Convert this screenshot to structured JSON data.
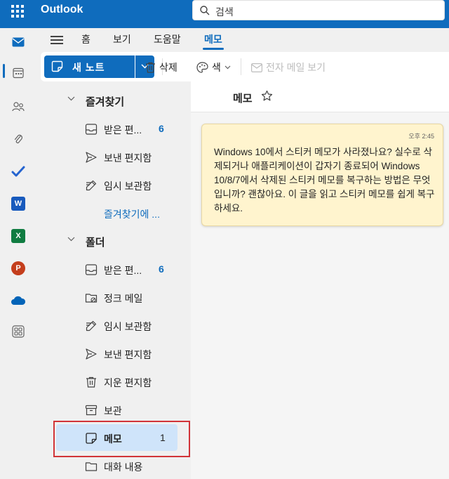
{
  "app": {
    "name": "Outlook"
  },
  "search": {
    "placeholder": "검색"
  },
  "rail": {
    "icons": [
      "mail-icon",
      "calendar-icon",
      "people-icon",
      "attachment-icon",
      "todo-icon",
      "word-icon",
      "excel-icon",
      "powerpoint-icon",
      "onedrive-icon",
      "more-apps-icon"
    ],
    "apps": {
      "word": "W",
      "excel": "X",
      "powerpoint": "P"
    },
    "colors": {
      "word": "#185abd",
      "excel": "#107c41",
      "powerpoint": "#c43e1c",
      "onedrive": "#0364b8",
      "todo": "#2564cf"
    }
  },
  "nav": {
    "tabs": [
      "홈",
      "보기",
      "도움말",
      "메모"
    ],
    "active": "메모"
  },
  "ribbon": {
    "new_note": "새 노트",
    "delete": "삭제",
    "color": "색",
    "view_email": "전자 메일 보기"
  },
  "folders": {
    "favorites": {
      "title": "즐겨찾기",
      "items": [
        {
          "label": "받은 편...",
          "count": "6",
          "icon": "inbox-icon"
        },
        {
          "label": "보낸 편지함",
          "icon": "send-icon"
        },
        {
          "label": "임시 보관함",
          "icon": "draft-icon"
        }
      ],
      "more": "즐겨찾기에 ..."
    },
    "folders": {
      "title": "폴더",
      "items": [
        {
          "label": "받은 편...",
          "count": "6",
          "icon": "inbox-icon"
        },
        {
          "label": "정크 메일",
          "icon": "junk-icon"
        },
        {
          "label": "임시 보관함",
          "icon": "draft-icon"
        },
        {
          "label": "보낸 편지함",
          "icon": "send-icon"
        },
        {
          "label": "지운 편지함",
          "icon": "trash-icon"
        },
        {
          "label": "보관",
          "icon": "archive-icon"
        },
        {
          "label": "메모",
          "count": "1",
          "icon": "note-icon",
          "selected": true
        },
        {
          "label": "대화 내용",
          "icon": "folder-icon"
        }
      ]
    }
  },
  "main": {
    "title": "메모",
    "note": {
      "time": "오후 2:45",
      "text": "Windows 10에서 스티커 메모가 사라졌나요? 실수로 삭제되거나 애플리케이션이 갑자기 종료되어 Windows 10/8/7에서 삭제된 스티커 메모를 복구하는 방법은 무엇입니까? 괜찮아요. 이 글을 읽고 스티커 메모를 쉽게 복구하세요."
    }
  },
  "colors": {
    "accent": "#0f6cbd",
    "note_bg": "#fff4ce",
    "highlight": "#d13438",
    "selected_bg": "#cfe4fa"
  }
}
